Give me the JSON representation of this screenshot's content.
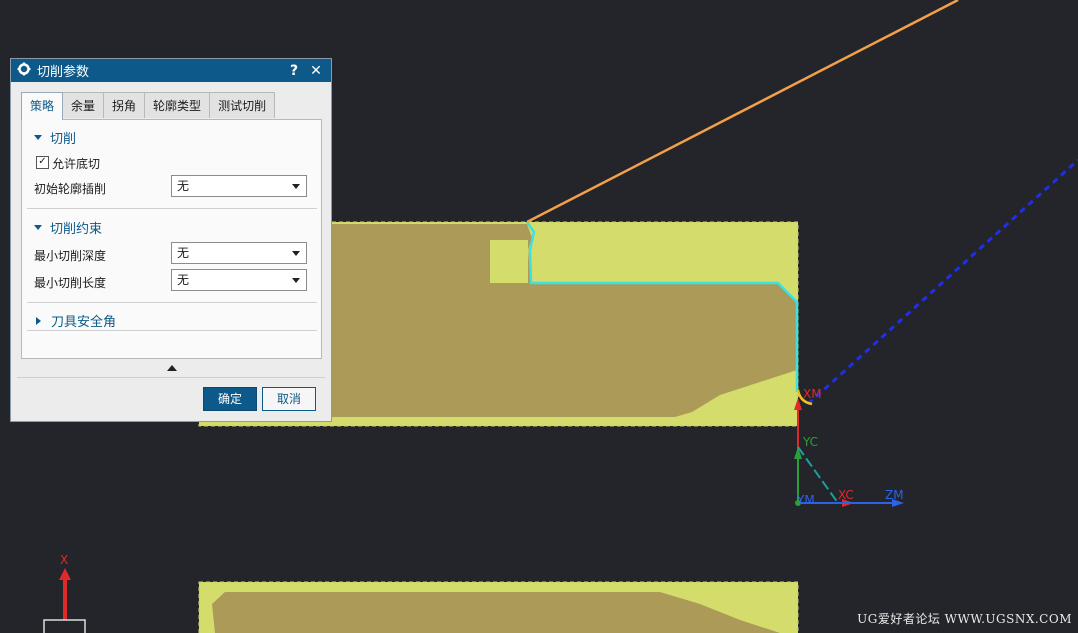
{
  "dialog": {
    "title": "切削参数",
    "help_glyph": "?",
    "close_glyph": "✕",
    "tabs": [
      {
        "label": "策略",
        "active": true
      },
      {
        "label": "余量",
        "active": false
      },
      {
        "label": "拐角",
        "active": false
      },
      {
        "label": "轮廓类型",
        "active": false
      },
      {
        "label": "测试切削",
        "active": false
      }
    ],
    "sections": {
      "cut": {
        "title": "切削",
        "allow_undercut": {
          "label": "允许底切",
          "checked": true
        },
        "initial_profile_insert": {
          "label": "初始轮廓插削",
          "value": "无"
        }
      },
      "cut_constraints": {
        "title": "切削约束",
        "min_cut_depth": {
          "label": "最小切削深度",
          "value": "无"
        },
        "min_cut_length": {
          "label": "最小切削长度",
          "value": "无"
        }
      },
      "tool_safety_angle": {
        "title": "刀具安全角"
      }
    },
    "ok_label": "确定",
    "cancel_label": "取消"
  },
  "viewport": {
    "labels": {
      "xm": "XM",
      "yc": "YC",
      "ym": "YM",
      "xc": "XC",
      "zm": "ZM",
      "x": "X"
    },
    "colors": {
      "background": "#23252a",
      "stock_light": "#d4dc6c",
      "part_fill": "#ab9a58",
      "boundary": "#3fe0e0",
      "approach": "#f3a04a",
      "retract": "#1f2fe8",
      "axis_x": "#e02a2a",
      "axis_y": "#29a03a",
      "axis_z": "#2b62e8"
    }
  },
  "watermark": "UG爱好者论坛 WWW.UGSNX.COM"
}
